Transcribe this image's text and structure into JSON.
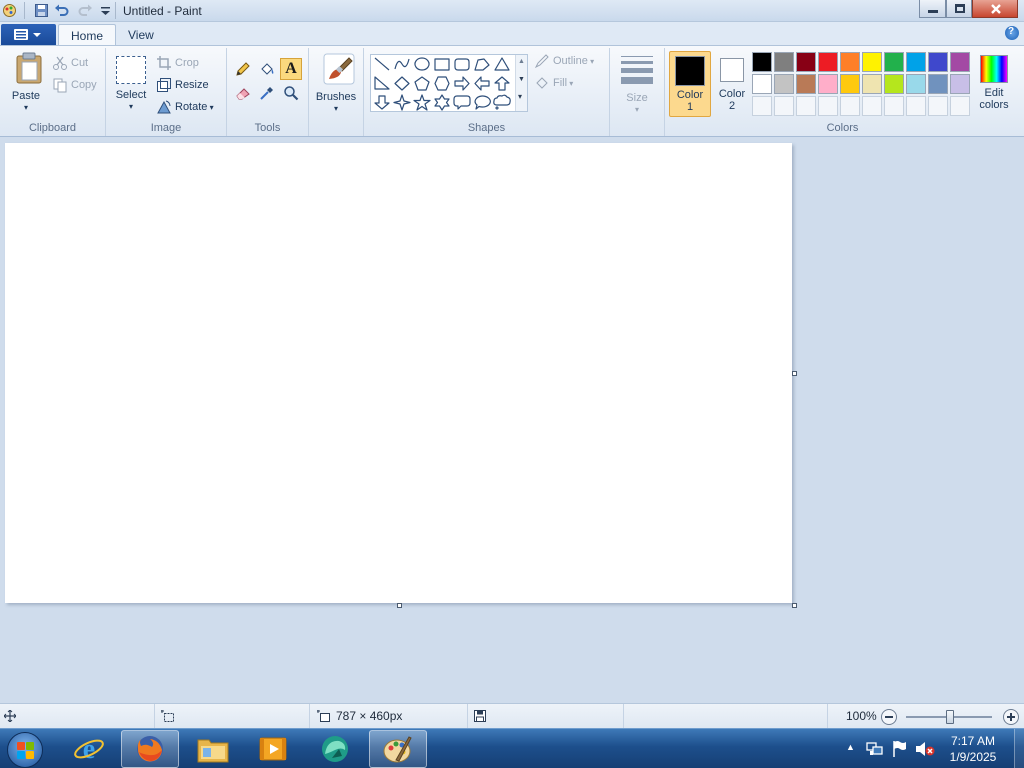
{
  "window": {
    "title": "Untitled - Paint"
  },
  "tabs": [
    {
      "label": "Home",
      "active": true
    },
    {
      "label": "View",
      "active": false
    }
  ],
  "ribbon": {
    "clipboard": {
      "group_label": "Clipboard",
      "paste_label": "Paste",
      "cut_label": "Cut",
      "copy_label": "Copy"
    },
    "image": {
      "group_label": "Image",
      "select_label": "Select",
      "crop_label": "Crop",
      "resize_label": "Resize",
      "rotate_label": "Rotate"
    },
    "tools": {
      "group_label": "Tools",
      "items": [
        "pencil-icon",
        "fill-icon",
        "text-icon",
        "eraser-icon",
        "color-picker-icon",
        "magnifier-icon"
      ],
      "selected": "text-icon"
    },
    "brushes": {
      "label": "Brushes"
    },
    "shapes": {
      "group_label": "Shapes",
      "outline_label": "Outline",
      "fill_label": "Fill",
      "items": [
        "line",
        "curve",
        "oval",
        "rectangle",
        "rounded-rectangle",
        "polygon",
        "triangle",
        "right-triangle",
        "diamond",
        "pentagon",
        "hexagon",
        "right-arrow",
        "left-arrow",
        "up-arrow",
        "down-arrow",
        "four-point-star",
        "five-point-star",
        "six-point-star",
        "rounded-callout",
        "oval-callout",
        "cloud-callout"
      ]
    },
    "size": {
      "label": "Size"
    },
    "colors": {
      "group_label": "Colors",
      "color1_label_line1": "Color",
      "color1_label_line2": "1",
      "color1_value": "#000000",
      "color2_label_line1": "Color",
      "color2_label_line2": "2",
      "color2_value": "#ffffff",
      "edit_label_line1": "Edit",
      "edit_label_line2": "colors",
      "palette_row1": [
        "#000000",
        "#7f7f7f",
        "#880015",
        "#ed1c24",
        "#ff7f27",
        "#fff200",
        "#22b14c",
        "#00a2e8",
        "#3f48cc",
        "#a349a4"
      ],
      "palette_row2": [
        "#ffffff",
        "#c3c3c3",
        "#b97a57",
        "#ffaec9",
        "#ffc90e",
        "#efe4b0",
        "#b5e61d",
        "#99d9ea",
        "#7092be",
        "#c8bfe7"
      ]
    }
  },
  "canvas": {
    "background": "#ffffff"
  },
  "statusbar": {
    "dimensions": "787 × 460px",
    "zoom": "100%"
  },
  "taskbar": {
    "apps": [
      "internet-explorer-icon",
      "firefox-icon",
      "file-explorer-icon",
      "media-player-icon",
      "app-icon",
      "paint-icon"
    ],
    "time": "7:17 AM",
    "date": "1/9/2025"
  }
}
